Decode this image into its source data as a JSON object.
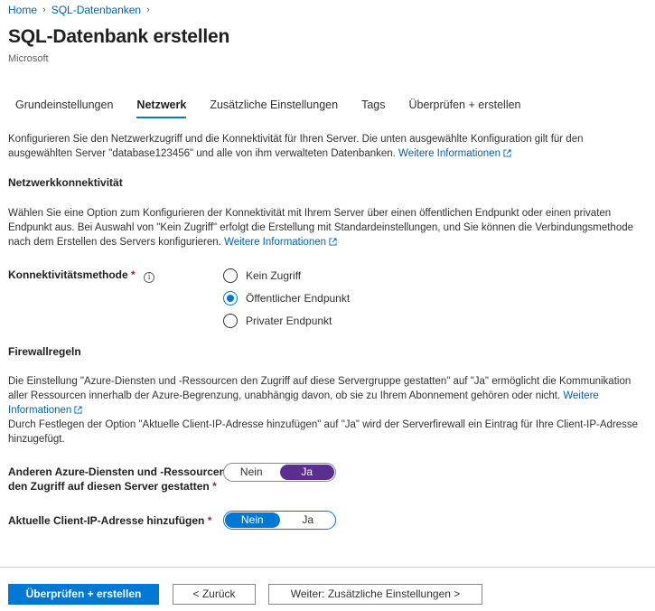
{
  "breadcrumb": {
    "home": "Home",
    "current": "SQL-Datenbanken"
  },
  "page": {
    "title": "SQL-Datenbank erstellen",
    "subtitle": "Microsoft"
  },
  "tabs": [
    {
      "label": "Grundeinstellungen",
      "active": false
    },
    {
      "label": "Netzwerk",
      "active": true
    },
    {
      "label": "Zusätzliche Einstellungen",
      "active": false
    },
    {
      "label": "Tags",
      "active": false
    },
    {
      "label": "Überprüfen + erstellen",
      "active": false
    }
  ],
  "intro": {
    "text": "Konfigurieren Sie den Netzwerkzugriff und die Konnektivität für Ihren Server. Die unten ausgewählte Konfiguration gilt für den ausgewählten Server \"database123456\" und alle von ihm verwalteten Datenbanken.",
    "link": "Weitere Informationen"
  },
  "connectivity": {
    "title": "Netzwerkkonnektivität",
    "text": "Wählen Sie eine Option zum Konfigurieren der Konnektivität mit Ihrem Server über einen öffentlichen Endpunkt oder einen privaten Endpunkt aus. Bei Auswahl von \"Kein Zugriff\" erfolgt die Erstellung mit Standardeinstellungen, und Sie können die Verbindungsmethode nach dem Erstellen des Servers konfigurieren.",
    "link": "Weitere Informationen",
    "method_label": "Konnektivitätsmethode",
    "required_mark": "*",
    "options": [
      "Kein Zugriff",
      "Öffentlicher Endpunkt",
      "Privater Endpunkt"
    ],
    "selected": "Öffentlicher Endpunkt"
  },
  "firewall": {
    "title": "Firewallregeln",
    "text1": "Die Einstellung \"Azure-Diensten und -Ressourcen den Zugriff auf diese Servergruppe gestatten\" auf \"Ja\" ermöglicht die Kommunikation aller Ressourcen innerhalb der Azure-Begrenzung, unabhängig davon, ob sie zu Ihrem Abonnement gehören oder nicht.",
    "link": "Weitere Informationen",
    "text2": "Durch Festlegen der Option \"Aktuelle Client-IP-Adresse hinzufügen\" auf \"Ja\" wird der Serverfirewall ein Eintrag für Ihre Client-IP-Adresse hinzugefügt.",
    "allow_azure_label_line1": "Anderen Azure-Diensten und -Ressourcen",
    "allow_azure_label_line2": "den Zugriff auf diesen Server gestatten",
    "allow_azure_value": "Ja",
    "add_ip_label": "Aktuelle Client-IP-Adresse hinzufügen",
    "add_ip_value": "Nein",
    "no_label": "Nein",
    "yes_label": "Ja",
    "required_mark": "*"
  },
  "footer": {
    "review_create": "Überprüfen + erstellen",
    "back": "< Zurück",
    "next": "Weiter: Zusätzliche Einstellungen >"
  },
  "colors": {
    "accent": "#0078d4",
    "toggle_on": "#5c2e91",
    "link": "#0062ad",
    "required": "#a4262c"
  },
  "icons": [
    "chevron-right-icon",
    "external-link-icon",
    "info-icon"
  ]
}
